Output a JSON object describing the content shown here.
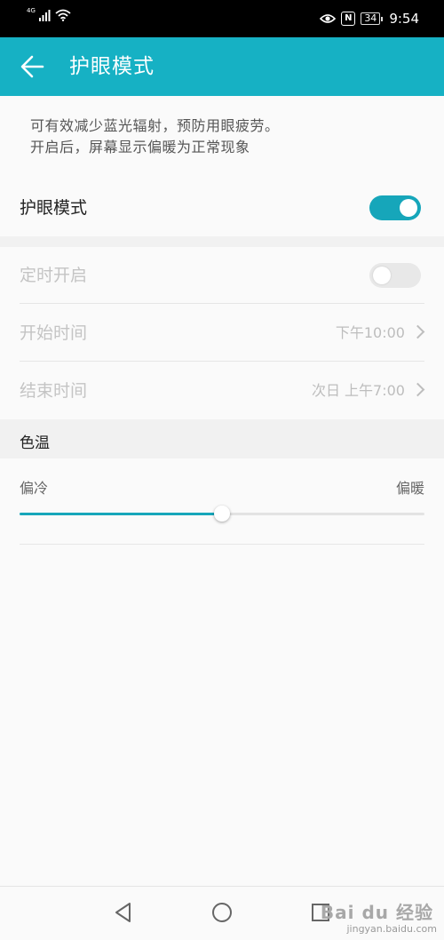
{
  "status_bar": {
    "network": "4G",
    "battery": "34",
    "time": "9:54",
    "nfc": "N"
  },
  "app_bar": {
    "title": "护眼模式"
  },
  "description": {
    "line1": "可有效减少蓝光辐射，预防用眼疲劳。",
    "line2": "开启后，屏幕显示偏暖为正常现象"
  },
  "eye_comfort": {
    "label": "护眼模式",
    "enabled": true
  },
  "schedule": {
    "label": "定时开启",
    "enabled": false
  },
  "start_time": {
    "label": "开始时间",
    "value": "下午10:00"
  },
  "end_time": {
    "label": "结束时间",
    "value": "次日 上午7:00"
  },
  "color_temperature": {
    "header": "色温",
    "left_label": "偏冷",
    "right_label": "偏暖",
    "level": 0.5
  },
  "nav_bar": {
    "icons": [
      "back-triangle-icon",
      "home-circle-icon",
      "recents-square-icon"
    ]
  },
  "watermark": {
    "brand": "Bai du 经验",
    "url": "jingyan.baidu.com"
  },
  "colors": {
    "accent": "#16b1c4",
    "toggle_on": "#16a6ba"
  }
}
